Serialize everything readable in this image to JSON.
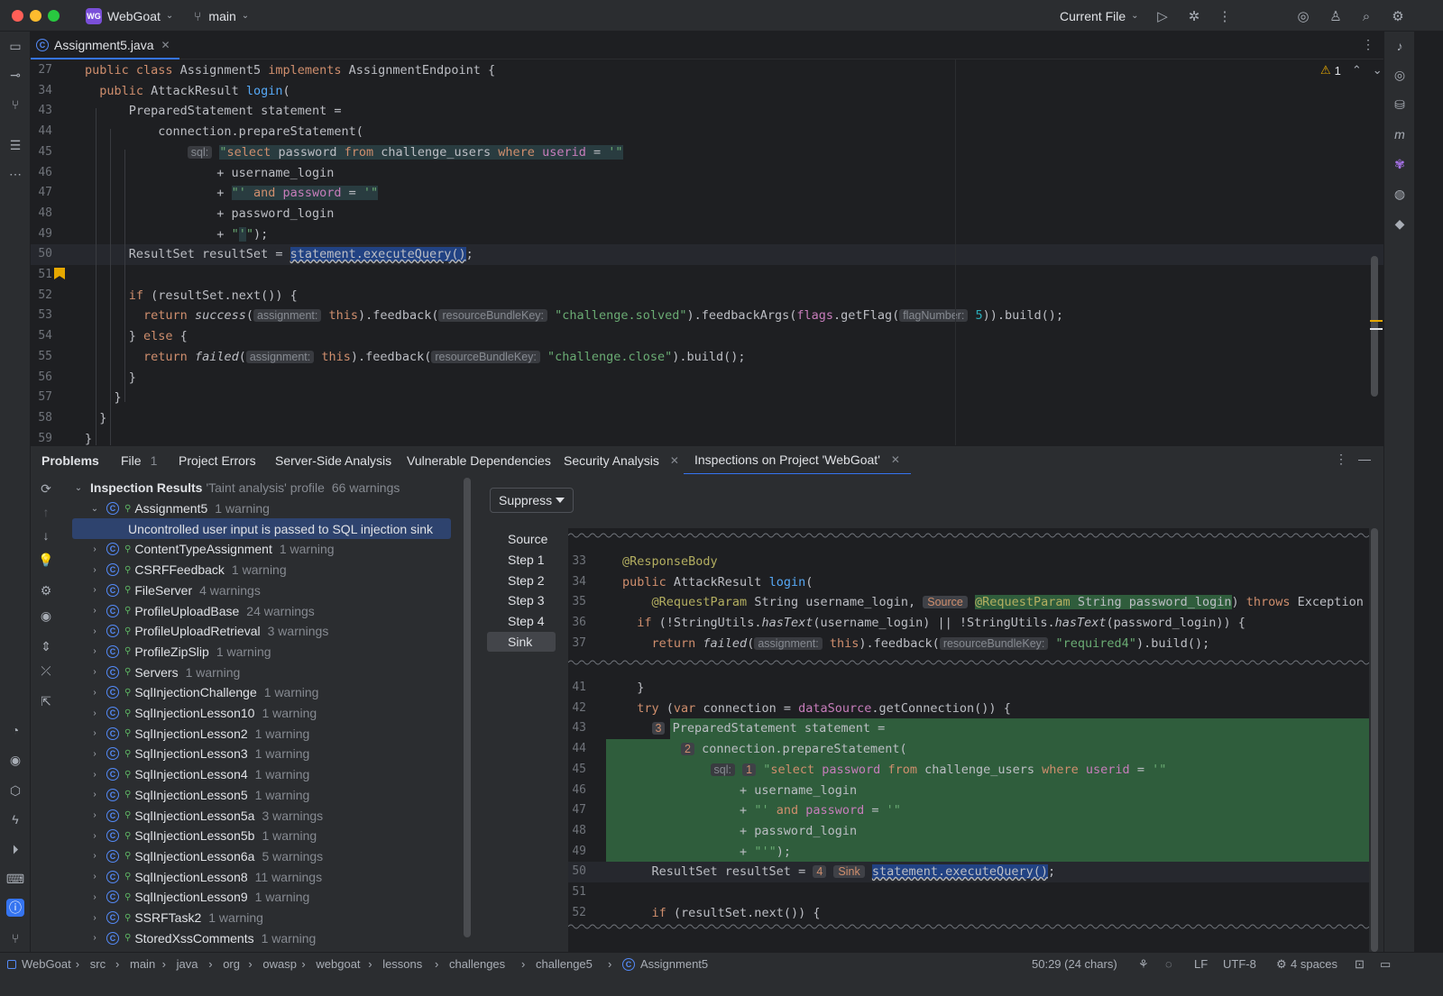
{
  "titlebar": {
    "project_badge": "WG",
    "project_name": "WebGoat",
    "branch": "main",
    "run_config": "Current File"
  },
  "editor_tab": {
    "filename": "Assignment5.java"
  },
  "editor": {
    "warnings_count": "1",
    "lines": [
      {
        "n": "27",
        "html": "<span class='kw'>public class </span>Assignment5 <span class='kw'>implements </span>AssignmentEndpoint {"
      },
      {
        "n": "34",
        "html": "  <span class='kw'>public </span>AttackResult <span class='fn'>login</span>("
      },
      {
        "n": "43",
        "html": "      PreparedStatement statement ="
      },
      {
        "n": "44",
        "html": "          connection.prepareStatement("
      },
      {
        "n": "45",
        "html": "              <span class='hint'>sql:</span> <span class='sqlhl'><span class='str'>\"</span><span class='sqlkw'>select </span>password <span class='sqlkw'>from </span>challenge_users <span class='sqlkw'>where </span><span class='purple'>userid </span>= <span class='str'>'\"</span></span>"
      },
      {
        "n": "46",
        "html": "                  + username_login"
      },
      {
        "n": "47",
        "html": "                  + <span class='sqlhl'><span class='str'>\"' </span><span class='sqlkw'>and </span><span class='purple'>password </span>= <span class='str'>'\"</span></span>"
      },
      {
        "n": "48",
        "html": "                  + password_login"
      },
      {
        "n": "49",
        "html": "                  + <span class='str'>\"</span><span class='sqlhl str'>'</span><span class='str'>\"</span>);"
      },
      {
        "n": "50",
        "html": "      ResultSet resultSet = <span class='selhl'>statement.executeQuery()</span>;"
      },
      {
        "n": "51",
        "html": ""
      },
      {
        "n": "52",
        "html": "      <span class='kw'>if </span>(resultSet.next()) {"
      },
      {
        "n": "53",
        "html": "        <span class='kw'>return </span><span class='ital'>success</span>(<span class='hint'>assignment:</span> <span class='kw'>this</span>).feedback(<span class='hint'>resourceBundleKey:</span> <span class='str'>\"challenge.solved\"</span>).feedbackArgs(<span class='purple'>flags</span>.getFlag(<span class='hint'>flagNumber:</span> <span class='num'>5</span>)).build();"
      },
      {
        "n": "54",
        "html": "      } <span class='kw'>else </span>{"
      },
      {
        "n": "55",
        "html": "        <span class='kw'>return </span><span class='ital'>failed</span>(<span class='hint'>assignment:</span> <span class='kw'>this</span>).feedback(<span class='hint'>resourceBundleKey:</span> <span class='str'>\"challenge.close\"</span>).build();"
      },
      {
        "n": "56",
        "html": "      }"
      },
      {
        "n": "57",
        "html": "    }"
      },
      {
        "n": "58",
        "html": "  }"
      },
      {
        "n": "59",
        "html": "}"
      }
    ]
  },
  "problems": {
    "tabs": [
      {
        "label": "Problems",
        "count": ""
      },
      {
        "label": "File",
        "count": "1"
      },
      {
        "label": "Project Errors",
        "count": ""
      },
      {
        "label": "Server-Side Analysis",
        "count": ""
      },
      {
        "label": "Vulnerable Dependencies",
        "count": ""
      },
      {
        "label": "Security Analysis",
        "count": ""
      },
      {
        "label": "Inspections on Project 'WebGoat'",
        "count": ""
      }
    ],
    "tree_root": {
      "label": "Inspection Results",
      "profile": "'Taint analysis' profile",
      "count": "66 warnings"
    },
    "assignment5": {
      "label": "Assignment5",
      "count": "1 warning"
    },
    "selected_issue": "Uncontrolled user input is passed to SQL injection sink",
    "items": [
      {
        "label": "ContentTypeAssignment",
        "count": "1 warning"
      },
      {
        "label": "CSRFFeedback",
        "count": "1 warning"
      },
      {
        "label": "FileServer",
        "count": "4 warnings"
      },
      {
        "label": "ProfileUploadBase",
        "count": "24 warnings"
      },
      {
        "label": "ProfileUploadRetrieval",
        "count": "3 warnings"
      },
      {
        "label": "ProfileZipSlip",
        "count": "1 warning"
      },
      {
        "label": "Servers",
        "count": "1 warning"
      },
      {
        "label": "SqlInjectionChallenge",
        "count": "1 warning"
      },
      {
        "label": "SqlInjectionLesson10",
        "count": "1 warning"
      },
      {
        "label": "SqlInjectionLesson2",
        "count": "1 warning"
      },
      {
        "label": "SqlInjectionLesson3",
        "count": "1 warning"
      },
      {
        "label": "SqlInjectionLesson4",
        "count": "1 warning"
      },
      {
        "label": "SqlInjectionLesson5",
        "count": "1 warning"
      },
      {
        "label": "SqlInjectionLesson5a",
        "count": "3 warnings"
      },
      {
        "label": "SqlInjectionLesson5b",
        "count": "1 warning"
      },
      {
        "label": "SqlInjectionLesson6a",
        "count": "5 warnings"
      },
      {
        "label": "SqlInjectionLesson8",
        "count": "11 warnings"
      },
      {
        "label": "SqlInjectionLesson9",
        "count": "1 warning"
      },
      {
        "label": "SSRFTask2",
        "count": "1 warning"
      },
      {
        "label": "StoredXssComments",
        "count": "1 warning"
      }
    ],
    "suppress_label": "Suppress",
    "steps": [
      "Source",
      "Step 1",
      "Step 2",
      "Step 3",
      "Step 4",
      "Sink"
    ],
    "snippet": [
      {
        "n": "33",
        "html": "<span class='anno'>@ResponseBody</span>",
        "taint": false
      },
      {
        "n": "34",
        "html": "<span class='kw'>public </span>AttackResult <span class='fn'>login</span>(",
        "taint": false
      },
      {
        "n": "35",
        "html": "    <span class='anno'>@RequestParam</span> String username_login, <span class='badge-lbl'>Source</span> <span class='greenbox'><span class='anno'>@RequestParam</span> String password_login</span>) <span class='kw'>throws </span>Exception {",
        "taint": false
      },
      {
        "n": "36",
        "html": "  <span class='kw'>if </span>(!StringUtils.<span class='ital'>hasText</span>(username_login) || !StringUtils.<span class='ital'>hasText</span>(password_login)) {",
        "taint": false
      },
      {
        "n": "37",
        "html": "    <span class='kw'>return </span><span class='ital'>failed</span>(<span class='hint'>assignment:</span> <span class='kw'>this</span>).feedback(<span class='hint'>resourceBundleKey:</span> <span class='str'>\"required4\"</span>).build();",
        "taint": false
      },
      {
        "n": "41",
        "html": "  }",
        "taint": false
      },
      {
        "n": "42",
        "html": "  <span class='kw'>try </span>(<span class='kw'>var </span>connection = <span class='purple'>dataSource</span>.getConnection()) {",
        "taint": false
      },
      {
        "n": "43",
        "html": "    <span class='badge'>3</span> PreparedStatement statement =",
        "taint": true
      },
      {
        "n": "44",
        "html": "        <span class='badge'>2</span> connection.prepareStatement(",
        "taint": true
      },
      {
        "n": "45",
        "html": "            <span class='hint'>sql:</span> <span class='badge'>1</span> <span class='str'>\"</span><span class='sqlkw'>select </span><span class='purple'>password </span><span class='sqlkw'>from </span>challenge_users <span class='sqlkw'>where </span><span class='purple'>userid </span>= <span class='str'>'\"</span>",
        "taint": true
      },
      {
        "n": "46",
        "html": "                + username_login",
        "taint": true
      },
      {
        "n": "47",
        "html": "                + <span class='str'>\"' </span><span class='sqlkw'>and </span><span class='purple'>password </span>= <span class='str'>'\"</span>",
        "taint": true
      },
      {
        "n": "48",
        "html": "                + password_login",
        "taint": true
      },
      {
        "n": "49",
        "html": "                + <span class='str'>\"'\"</span>);",
        "taint": true
      },
      {
        "n": "50",
        "html": "    ResultSet resultSet = <span class='badge'>4</span> <span class='badge-lbl'>Sink</span> <span class='selhl'>statement.executeQuery()</span>;",
        "taint": false
      },
      {
        "n": "51",
        "html": "",
        "taint": false
      },
      {
        "n": "52",
        "html": "    <span class='kw'>if </span>(resultSet.next()) {",
        "taint": false
      }
    ]
  },
  "statusbar": {
    "breadcrumbs": [
      "WebGoat",
      "src",
      "main",
      "java",
      "org",
      "owasp",
      "webgoat",
      "lessons",
      "challenges",
      "challenge5",
      "Assignment5"
    ],
    "position": "50:29 (24 chars)",
    "line_sep": "LF",
    "encoding": "UTF-8",
    "indent": "4 spaces"
  }
}
